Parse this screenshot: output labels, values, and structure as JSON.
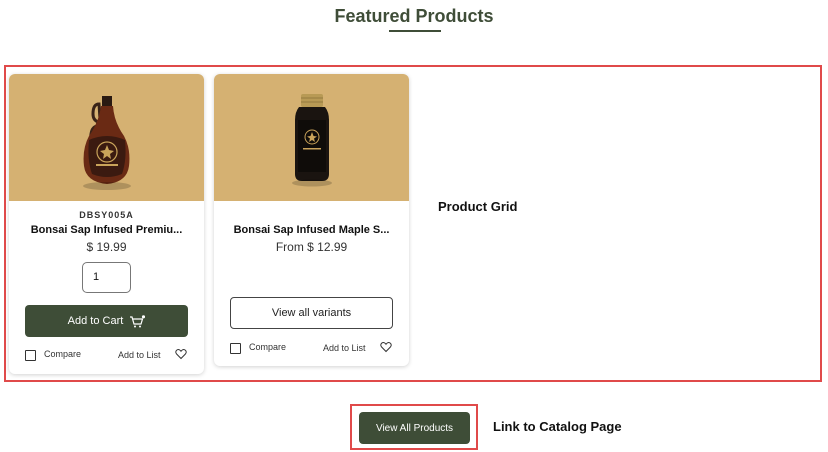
{
  "section": {
    "title": "Featured Products"
  },
  "colors": {
    "brand": "#3e4d37",
    "annotation": "#e04a4a",
    "image_bg": "#d5b172"
  },
  "annotations": {
    "grid_label": "Product Grid",
    "catalog_label": "Link to Catalog Page"
  },
  "products": [
    {
      "sku": "DBSY005A",
      "name": "Bonsai Sap Infused Premiu...",
      "price": "$ 19.99",
      "quantity": "1",
      "add_to_cart_label": "Add to Cart",
      "cart_icon": "cart-icon",
      "compare_label": "Compare",
      "add_to_list_label": "Add to List",
      "heart_icon": "heart-icon"
    },
    {
      "name": "Bonsai Sap Infused Maple S...",
      "price": "From $ 12.99",
      "variants_label": "View all variants",
      "compare_label": "Compare",
      "add_to_list_label": "Add to List",
      "heart_icon": "heart-icon"
    }
  ],
  "cta": {
    "view_all_label": "View All Products"
  }
}
